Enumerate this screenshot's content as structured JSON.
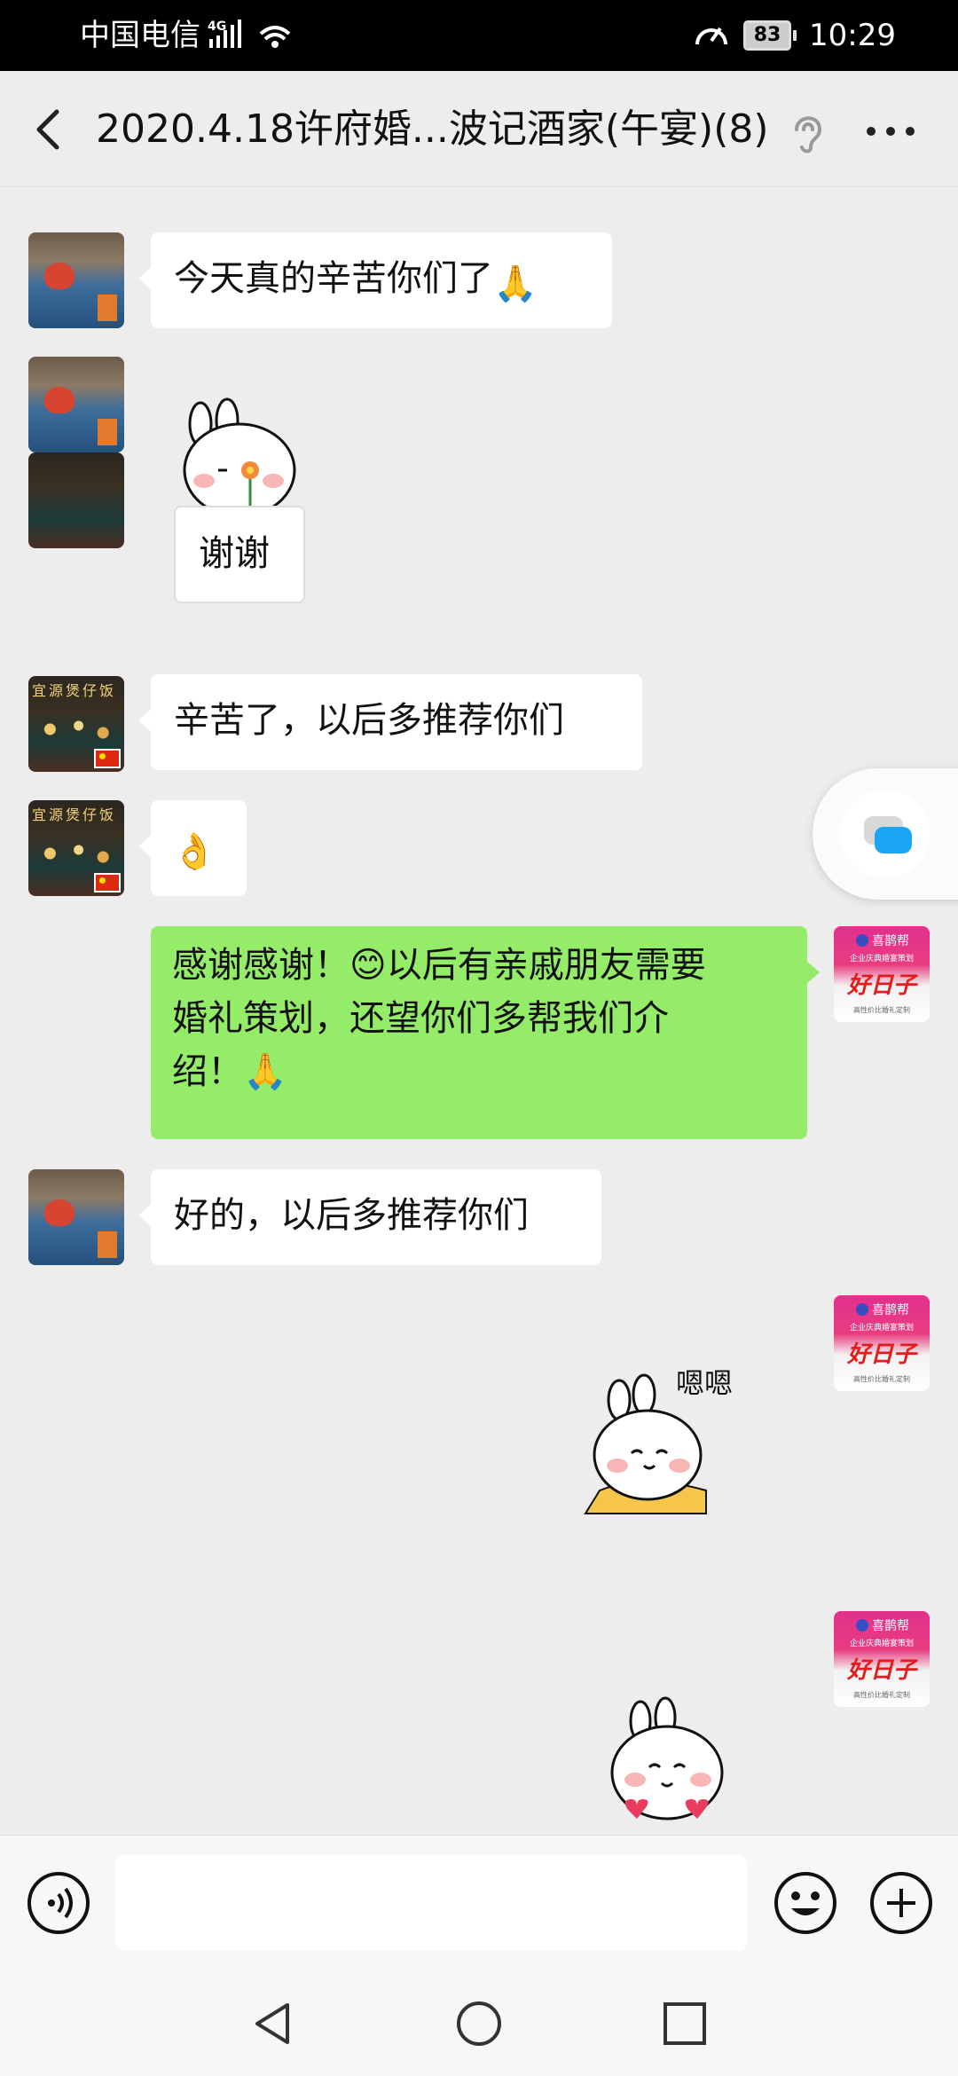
{
  "status_bar": {
    "carrier": "中国电信",
    "network": "4G",
    "battery": "83",
    "time": "10:29"
  },
  "header": {
    "title": "2020.4.18许府婚...波记酒家(午宴)(8)"
  },
  "messages": [
    {
      "side": "left",
      "sender_avatar": "bed-photo",
      "type": "text",
      "text": "今天真的辛苦你们了",
      "emoji": "🙏"
    },
    {
      "side": "left",
      "sender_avatar": "bed-photo",
      "type": "sticker",
      "sticker": "bunny-holding-flower",
      "caption": "谢谢"
    },
    {
      "side": "left",
      "sender_avatar": "shop-photo",
      "type": "text",
      "text": "辛苦了，以后多推荐你们"
    },
    {
      "side": "left",
      "sender_avatar": "shop-photo",
      "type": "emoji",
      "emoji": "👌"
    },
    {
      "side": "right",
      "sender_avatar": "business-logo",
      "type": "text",
      "text_lines": [
        "感谢感谢！😊以后有亲戚朋友需要",
        "婚礼策划，还望你们多帮我们介",
        "绍！🙏"
      ]
    },
    {
      "side": "left",
      "sender_avatar": "bed-photo",
      "type": "text",
      "text": "好的，以后多推荐你们"
    },
    {
      "side": "right",
      "sender_avatar": "business-logo",
      "type": "sticker",
      "sticker": "bunny-nodding",
      "caption": "嗯嗯"
    },
    {
      "side": "right",
      "sender_avatar": "business-logo",
      "type": "sticker",
      "sticker": "bunny-hearts"
    }
  ],
  "avatars": {
    "shop_sign": "宜源煲仔饭",
    "business_logo": "喜鹊帮",
    "business_sub": "企业庆典婚宴策划",
    "business_big": "好日子",
    "business_small": "高性价比婚礼定制"
  },
  "input": {
    "placeholder": ""
  },
  "colors": {
    "background": "#ededed",
    "outgoing_bubble": "#95ec69",
    "incoming_bubble": "#ffffff",
    "float_icon": "#1aa5f5"
  },
  "icons": [
    "back-arrow-icon",
    "ear-icon",
    "more-icon",
    "voice-icon",
    "emoji-icon",
    "plus-icon",
    "nav-back-icon",
    "nav-home-icon",
    "nav-recents-icon",
    "float-chat-icon"
  ]
}
